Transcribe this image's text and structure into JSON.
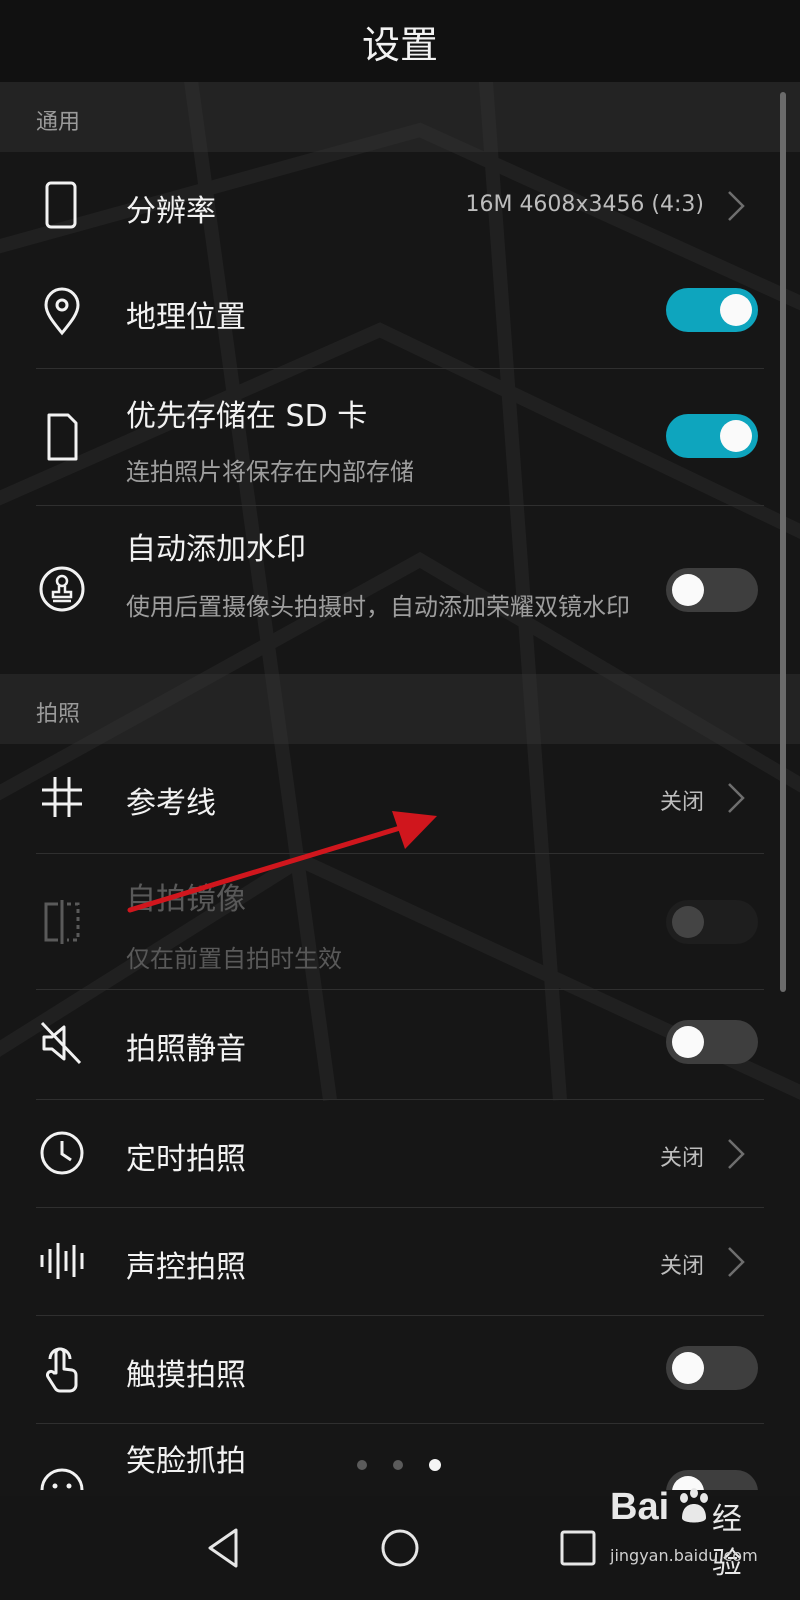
{
  "header": {
    "title": "设置"
  },
  "sections": {
    "general": "通用",
    "photo": "拍照"
  },
  "rows": {
    "resolution": {
      "label": "分辨率",
      "value": "16M 4608x3456 (4:3)"
    },
    "location": {
      "label": "地理位置",
      "state": "on"
    },
    "sd_card": {
      "label": "优先存储在 SD 卡",
      "sub": "连拍照片将保存在内部存储",
      "state": "on"
    },
    "watermark": {
      "label": "自动添加水印",
      "sub": "使用后置摄像头拍摄时，自动添加荣耀双镜水印",
      "state": "off"
    },
    "gridlines": {
      "label": "参考线",
      "value": "关闭"
    },
    "mirror": {
      "label": "自拍镜像",
      "sub": "仅在前置自拍时生效",
      "state": "disabled"
    },
    "mute": {
      "label": "拍照静音",
      "state": "off"
    },
    "timer": {
      "label": "定时拍照",
      "value": "关闭"
    },
    "voice": {
      "label": "声控拍照",
      "value": "关闭"
    },
    "touch": {
      "label": "触摸拍照",
      "state": "off"
    },
    "smile": {
      "label": "笑脸抓拍",
      "state": "off"
    }
  },
  "page_indicator": {
    "pages": 3,
    "active": 3
  },
  "navbar": {
    "back": "back-icon",
    "home": "home-icon",
    "recents": "recents-icon"
  },
  "watermark_logo": {
    "brand": "Bai",
    "cn": "经验",
    "url": "jingyan.baidu.com"
  },
  "colors": {
    "accent": "#0ea5be",
    "annotation_arrow": "#d0161d"
  }
}
